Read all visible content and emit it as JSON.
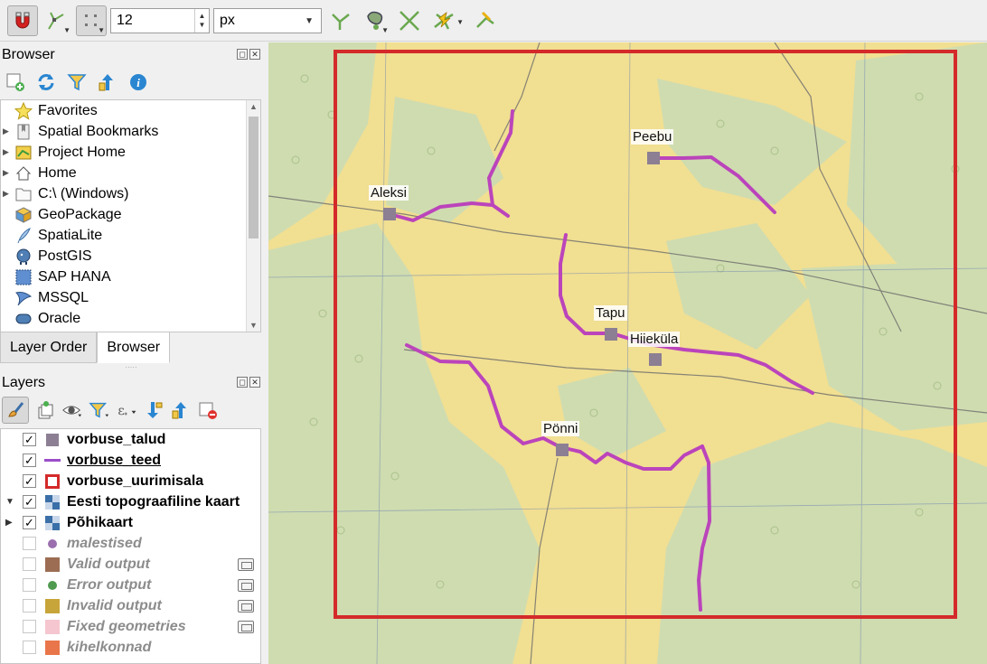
{
  "toolbar": {
    "snap_size_value": "12",
    "snap_unit": "px",
    "buttons": [
      "snapping-magnet-icon",
      "vertex-tool-icon",
      "snap-grid-icon",
      "topology-icon",
      "trace-icon",
      "intersection-icon",
      "avoid-overlap-icon",
      "self-snap-icon"
    ]
  },
  "browser": {
    "title": "Browser",
    "tools": [
      "add-layer-icon",
      "refresh-icon",
      "filter-icon",
      "collapse-icon",
      "info-icon"
    ],
    "items": [
      {
        "label": "Favorites",
        "icon": "star-icon",
        "expandable": false
      },
      {
        "label": "Spatial Bookmarks",
        "icon": "bookmark-icon",
        "expandable": true
      },
      {
        "label": "Project Home",
        "icon": "project-home-icon",
        "expandable": true
      },
      {
        "label": "Home",
        "icon": "home-icon",
        "expandable": true
      },
      {
        "label": "C:\\ (Windows)",
        "icon": "drive-icon",
        "expandable": true
      },
      {
        "label": "GeoPackage",
        "icon": "geopackage-icon",
        "expandable": false
      },
      {
        "label": "SpatiaLite",
        "icon": "spatialite-icon",
        "expandable": false
      },
      {
        "label": "PostGIS",
        "icon": "postgis-icon",
        "expandable": false
      },
      {
        "label": "SAP HANA",
        "icon": "sap-hana-icon",
        "expandable": false
      },
      {
        "label": "MSSQL",
        "icon": "mssql-icon",
        "expandable": false
      },
      {
        "label": "Oracle",
        "icon": "oracle-icon",
        "expandable": false
      }
    ]
  },
  "tabs": {
    "layer_order": "Layer Order",
    "browser": "Browser"
  },
  "layers": {
    "title": "Layers",
    "items": [
      {
        "name": "vorbuse_talud",
        "checked": true,
        "style": "bold",
        "symbol": "square-gray"
      },
      {
        "name": "vorbuse_teed",
        "checked": true,
        "style": "bold-underline",
        "symbol": "line-purple"
      },
      {
        "name": "vorbuse_uurimisala",
        "checked": true,
        "style": "bold",
        "symbol": "square-red-outline"
      },
      {
        "name": "Eesti topograafiline kaart",
        "checked": true,
        "style": "bold",
        "symbol": "raster",
        "expanded": true
      },
      {
        "name": "Põhikaart",
        "checked": true,
        "style": "bold",
        "symbol": "raster",
        "collapsed": true
      },
      {
        "name": "malestised",
        "checked": false,
        "style": "italic",
        "symbol": "dot-purple"
      },
      {
        "name": "Valid output",
        "checked": false,
        "style": "italic",
        "symbol": "square-brown",
        "memory": true
      },
      {
        "name": "Error output",
        "checked": false,
        "style": "italic",
        "symbol": "dot-green",
        "memory": true
      },
      {
        "name": "Invalid output",
        "checked": false,
        "style": "italic",
        "symbol": "square-gold",
        "memory": true
      },
      {
        "name": "Fixed geometries",
        "checked": false,
        "style": "italic",
        "symbol": "square-pink",
        "memory": true
      },
      {
        "name": "kihelkonnad",
        "checked": false,
        "style": "italic",
        "symbol": "square-orange"
      }
    ]
  },
  "map": {
    "farm_labels": [
      "Aleksi",
      "Peebu",
      "Tapu",
      "Hiieküla",
      "Pönni"
    ],
    "colors": {
      "road": "#bb44bb",
      "study_area": "#d42a2a",
      "farm": "#8c7f93",
      "forest": "#cfdcb0",
      "field": "#f1df92"
    }
  }
}
